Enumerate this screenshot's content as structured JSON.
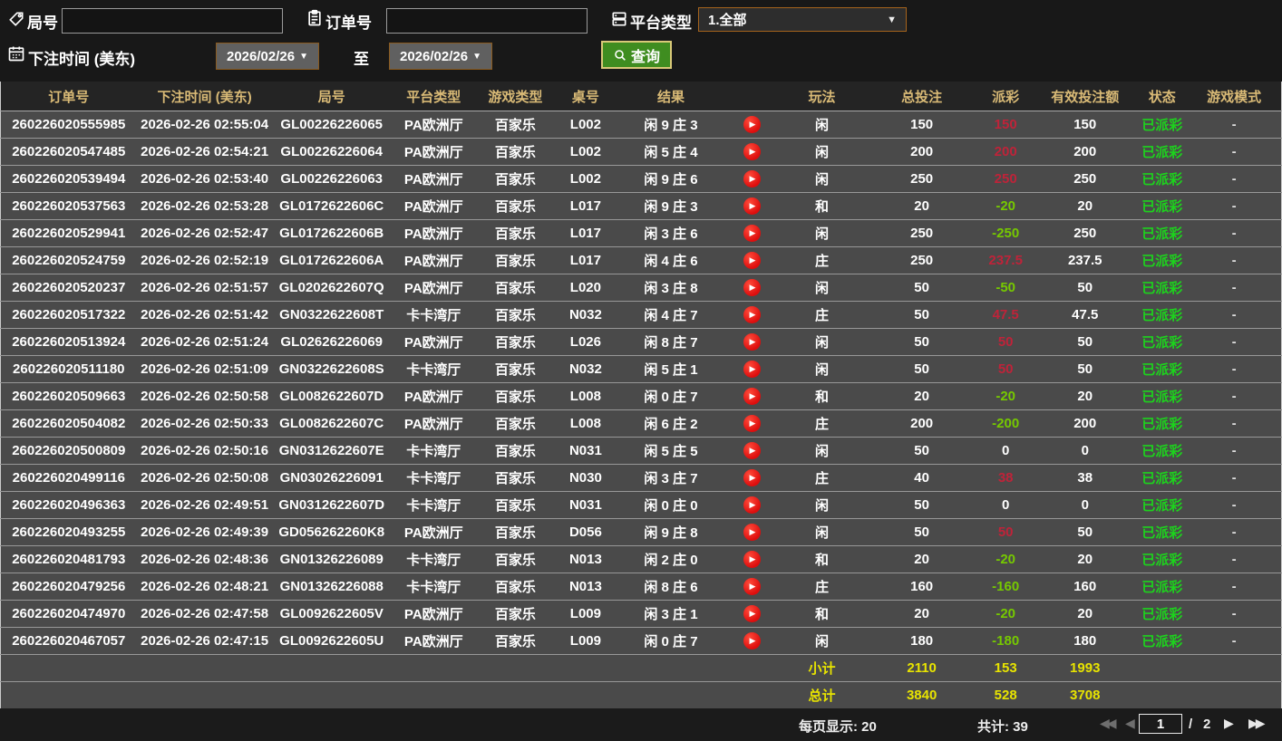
{
  "colors": {
    "accent_green": "#3f8d20",
    "header_text": "#d9ba76",
    "win_red": "#bf2339",
    "loss_green": "#76c900",
    "status_green": "#1dd21d",
    "totals_yellow": "#e8e400"
  },
  "filters": {
    "round_label": "局号",
    "round_value": "",
    "order_label": "订单号",
    "order_value": "",
    "platform_label": "平台类型",
    "platform_value": "1.全部",
    "time_label": "下注时间 (美东)",
    "date_from": "2026/02/26",
    "to_label": "至",
    "date_to": "2026/02/26",
    "search_label": "查询"
  },
  "table": {
    "columns": [
      "订单号",
      "下注时间 (美东)",
      "局号",
      "平台类型",
      "游戏类型",
      "桌号",
      "结果",
      "",
      "玩法",
      "总投注",
      "派彩",
      "有效投注额",
      "状态",
      "游戏模式"
    ],
    "rows": [
      {
        "order": "260226020555985",
        "time": "2026-02-26 02:55:04",
        "round": "GL00226226065",
        "platform": "PA欧洲厅",
        "game": "百家乐",
        "table": "L002",
        "result": "闲 9 庄 3",
        "method": "闲",
        "bet": "150",
        "payout": "150",
        "valid": "150",
        "status": "已派彩",
        "mode": "-"
      },
      {
        "order": "260226020547485",
        "time": "2026-02-26 02:54:21",
        "round": "GL00226226064",
        "platform": "PA欧洲厅",
        "game": "百家乐",
        "table": "L002",
        "result": "闲 5 庄 4",
        "method": "闲",
        "bet": "200",
        "payout": "200",
        "valid": "200",
        "status": "已派彩",
        "mode": "-"
      },
      {
        "order": "260226020539494",
        "time": "2026-02-26 02:53:40",
        "round": "GL00226226063",
        "platform": "PA欧洲厅",
        "game": "百家乐",
        "table": "L002",
        "result": "闲 9 庄 6",
        "method": "闲",
        "bet": "250",
        "payout": "250",
        "valid": "250",
        "status": "已派彩",
        "mode": "-"
      },
      {
        "order": "260226020537563",
        "time": "2026-02-26 02:53:28",
        "round": "GL0172622606C",
        "platform": "PA欧洲厅",
        "game": "百家乐",
        "table": "L017",
        "result": "闲 9 庄 3",
        "method": "和",
        "bet": "20",
        "payout": "-20",
        "valid": "20",
        "status": "已派彩",
        "mode": "-"
      },
      {
        "order": "260226020529941",
        "time": "2026-02-26 02:52:47",
        "round": "GL0172622606B",
        "platform": "PA欧洲厅",
        "game": "百家乐",
        "table": "L017",
        "result": "闲 3 庄 6",
        "method": "闲",
        "bet": "250",
        "payout": "-250",
        "valid": "250",
        "status": "已派彩",
        "mode": "-"
      },
      {
        "order": "260226020524759",
        "time": "2026-02-26 02:52:19",
        "round": "GL0172622606A",
        "platform": "PA欧洲厅",
        "game": "百家乐",
        "table": "L017",
        "result": "闲 4 庄 6",
        "method": "庄",
        "bet": "250",
        "payout": "237.5",
        "valid": "237.5",
        "status": "已派彩",
        "mode": "-"
      },
      {
        "order": "260226020520237",
        "time": "2026-02-26 02:51:57",
        "round": "GL0202622607Q",
        "platform": "PA欧洲厅",
        "game": "百家乐",
        "table": "L020",
        "result": "闲 3 庄 8",
        "method": "闲",
        "bet": "50",
        "payout": "-50",
        "valid": "50",
        "status": "已派彩",
        "mode": "-"
      },
      {
        "order": "260226020517322",
        "time": "2026-02-26 02:51:42",
        "round": "GN0322622608T",
        "platform": "卡卡湾厅",
        "game": "百家乐",
        "table": "N032",
        "result": "闲 4 庄 7",
        "method": "庄",
        "bet": "50",
        "payout": "47.5",
        "valid": "47.5",
        "status": "已派彩",
        "mode": "-"
      },
      {
        "order": "260226020513924",
        "time": "2026-02-26 02:51:24",
        "round": "GL02626226069",
        "platform": "PA欧洲厅",
        "game": "百家乐",
        "table": "L026",
        "result": "闲 8 庄 7",
        "method": "闲",
        "bet": "50",
        "payout": "50",
        "valid": "50",
        "status": "已派彩",
        "mode": "-"
      },
      {
        "order": "260226020511180",
        "time": "2026-02-26 02:51:09",
        "round": "GN0322622608S",
        "platform": "卡卡湾厅",
        "game": "百家乐",
        "table": "N032",
        "result": "闲 5 庄 1",
        "method": "闲",
        "bet": "50",
        "payout": "50",
        "valid": "50",
        "status": "已派彩",
        "mode": "-"
      },
      {
        "order": "260226020509663",
        "time": "2026-02-26 02:50:58",
        "round": "GL0082622607D",
        "platform": "PA欧洲厅",
        "game": "百家乐",
        "table": "L008",
        "result": "闲 0 庄 7",
        "method": "和",
        "bet": "20",
        "payout": "-20",
        "valid": "20",
        "status": "已派彩",
        "mode": "-"
      },
      {
        "order": "260226020504082",
        "time": "2026-02-26 02:50:33",
        "round": "GL0082622607C",
        "platform": "PA欧洲厅",
        "game": "百家乐",
        "table": "L008",
        "result": "闲 6 庄 2",
        "method": "庄",
        "bet": "200",
        "payout": "-200",
        "valid": "200",
        "status": "已派彩",
        "mode": "-"
      },
      {
        "order": "260226020500809",
        "time": "2026-02-26 02:50:16",
        "round": "GN0312622607E",
        "platform": "卡卡湾厅",
        "game": "百家乐",
        "table": "N031",
        "result": "闲 5 庄 5",
        "method": "闲",
        "bet": "50",
        "payout": "0",
        "valid": "0",
        "status": "已派彩",
        "mode": "-"
      },
      {
        "order": "260226020499116",
        "time": "2026-02-26 02:50:08",
        "round": "GN03026226091",
        "platform": "卡卡湾厅",
        "game": "百家乐",
        "table": "N030",
        "result": "闲 3 庄 7",
        "method": "庄",
        "bet": "40",
        "payout": "38",
        "valid": "38",
        "status": "已派彩",
        "mode": "-"
      },
      {
        "order": "260226020496363",
        "time": "2026-02-26 02:49:51",
        "round": "GN0312622607D",
        "platform": "卡卡湾厅",
        "game": "百家乐",
        "table": "N031",
        "result": "闲 0 庄 0",
        "method": "闲",
        "bet": "50",
        "payout": "0",
        "valid": "0",
        "status": "已派彩",
        "mode": "-"
      },
      {
        "order": "260226020493255",
        "time": "2026-02-26 02:49:39",
        "round": "GD056262260K8",
        "platform": "PA欧洲厅",
        "game": "百家乐",
        "table": "D056",
        "result": "闲 9 庄 8",
        "method": "闲",
        "bet": "50",
        "payout": "50",
        "valid": "50",
        "status": "已派彩",
        "mode": "-"
      },
      {
        "order": "260226020481793",
        "time": "2026-02-26 02:48:36",
        "round": "GN01326226089",
        "platform": "卡卡湾厅",
        "game": "百家乐",
        "table": "N013",
        "result": "闲 2 庄 0",
        "method": "和",
        "bet": "20",
        "payout": "-20",
        "valid": "20",
        "status": "已派彩",
        "mode": "-"
      },
      {
        "order": "260226020479256",
        "time": "2026-02-26 02:48:21",
        "round": "GN01326226088",
        "platform": "卡卡湾厅",
        "game": "百家乐",
        "table": "N013",
        "result": "闲 8 庄 6",
        "method": "庄",
        "bet": "160",
        "payout": "-160",
        "valid": "160",
        "status": "已派彩",
        "mode": "-"
      },
      {
        "order": "260226020474970",
        "time": "2026-02-26 02:47:58",
        "round": "GL0092622605V",
        "platform": "PA欧洲厅",
        "game": "百家乐",
        "table": "L009",
        "result": "闲 3 庄 1",
        "method": "和",
        "bet": "20",
        "payout": "-20",
        "valid": "20",
        "status": "已派彩",
        "mode": "-"
      },
      {
        "order": "260226020467057",
        "time": "2026-02-26 02:47:15",
        "round": "GL0092622605U",
        "platform": "PA欧洲厅",
        "game": "百家乐",
        "table": "L009",
        "result": "闲 0 庄 7",
        "method": "闲",
        "bet": "180",
        "payout": "-180",
        "valid": "180",
        "status": "已派彩",
        "mode": "-"
      }
    ],
    "subtotal": {
      "label": "小计",
      "bet": "2110",
      "payout": "153",
      "valid": "1993"
    },
    "total": {
      "label": "总计",
      "bet": "3840",
      "payout": "528",
      "valid": "3708"
    }
  },
  "footer": {
    "page_size_label": "每页显示:",
    "page_size": "20",
    "total_label": "共计:",
    "total_count": "39",
    "current_page": "1",
    "page_separator": "/",
    "total_pages": "2"
  }
}
